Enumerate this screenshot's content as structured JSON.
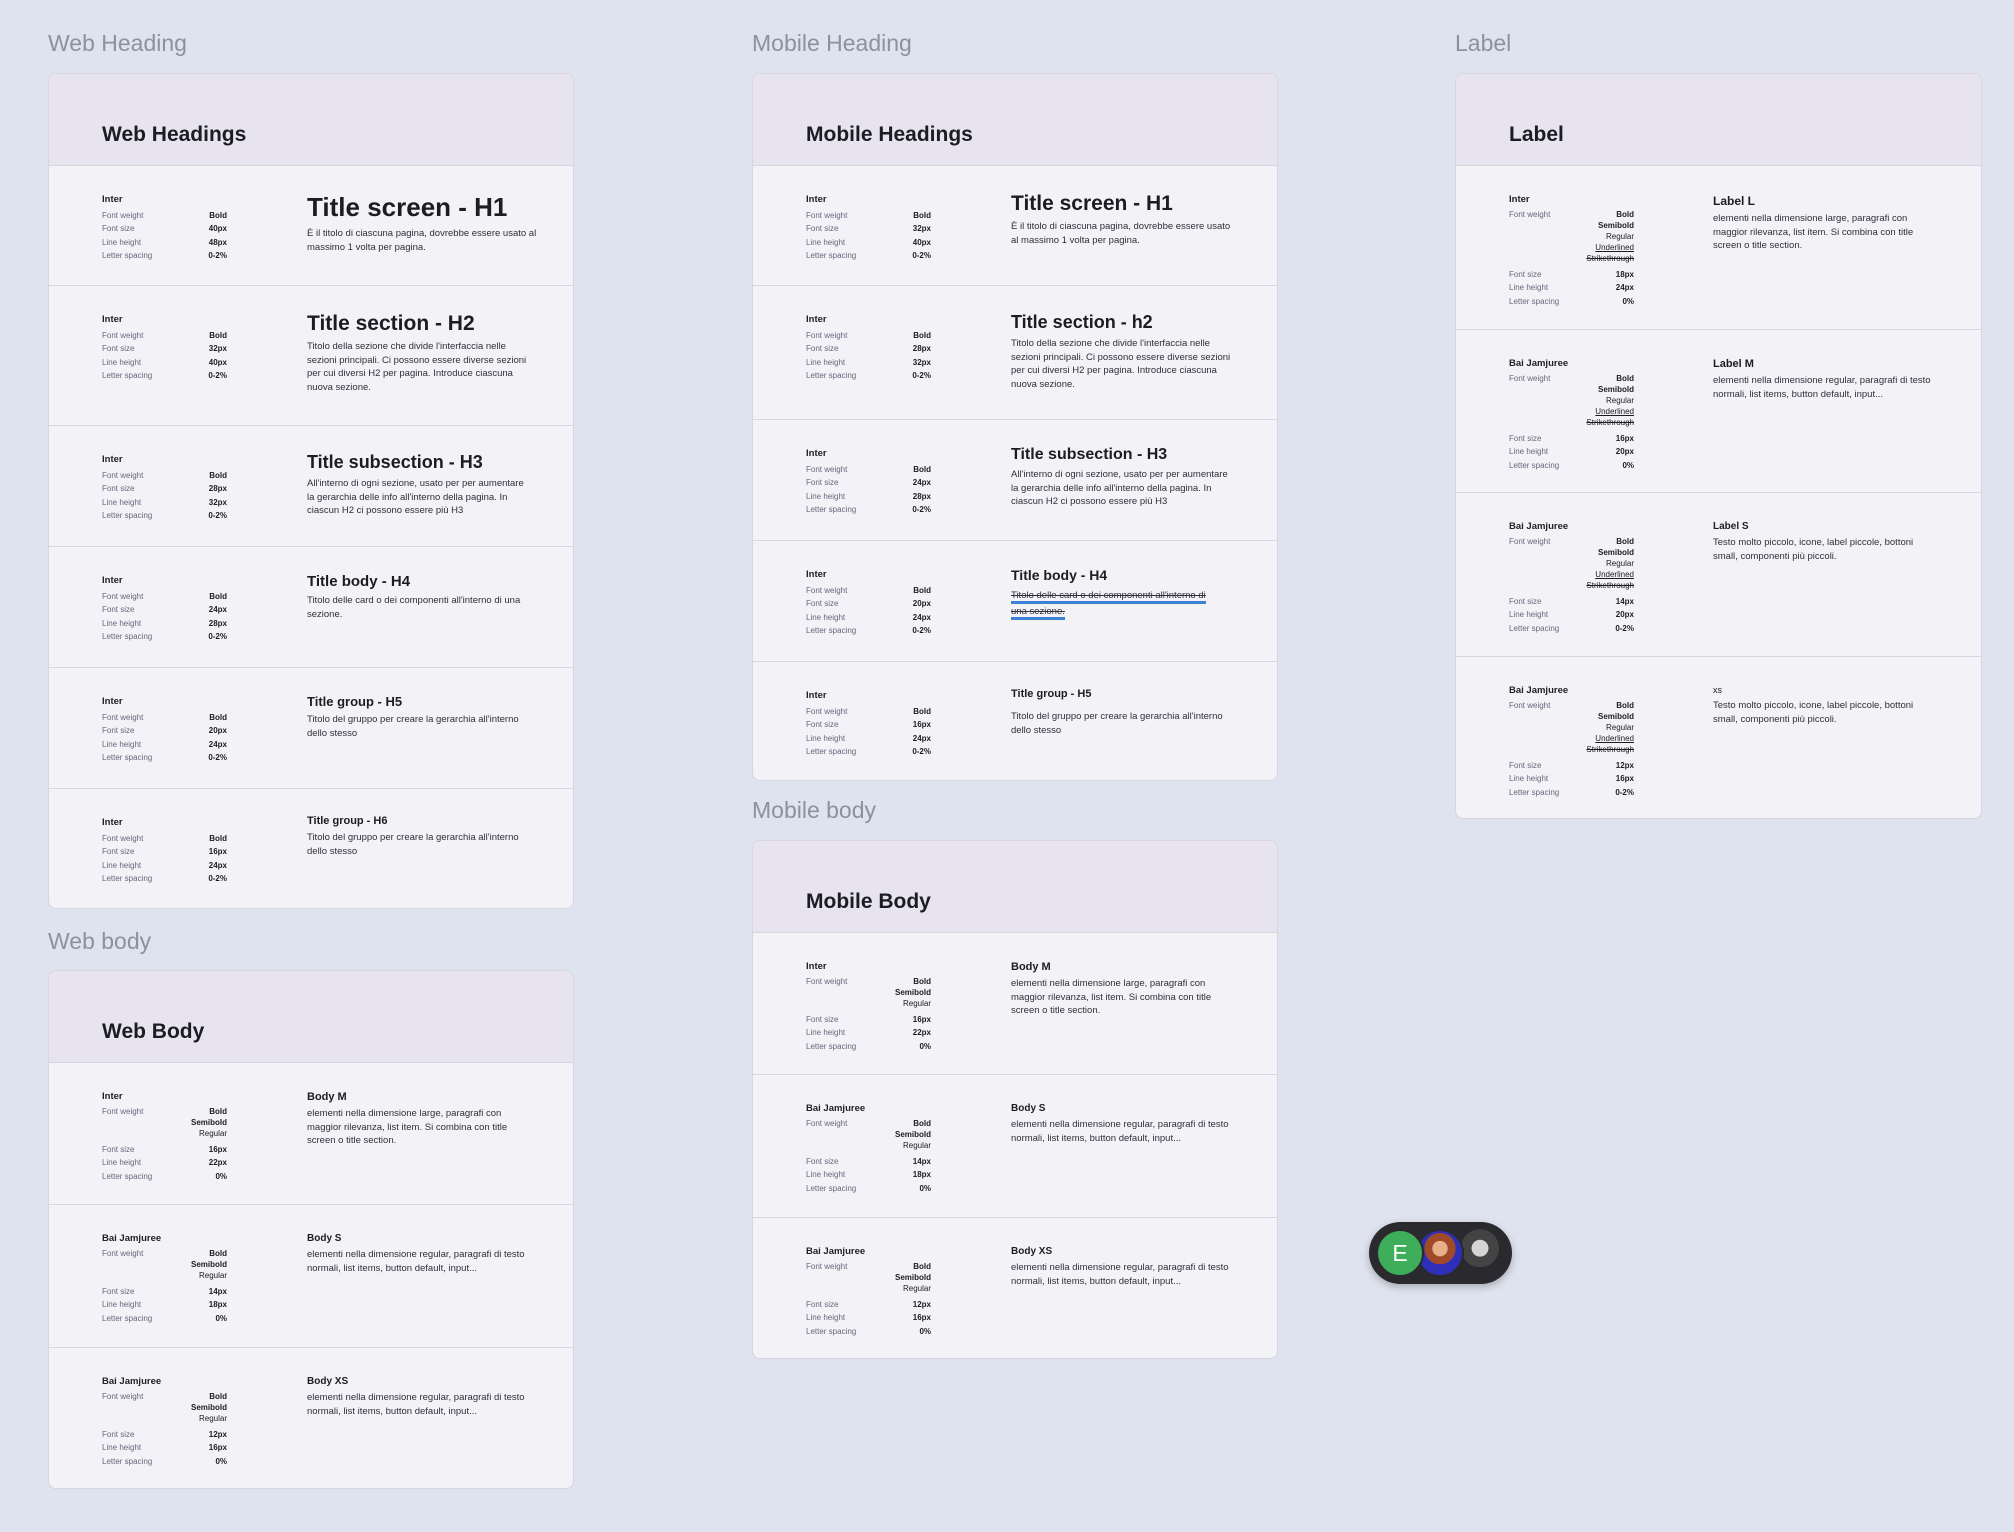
{
  "labels": {
    "web_heading": "Web Heading",
    "mobile_heading": "Mobile Heading",
    "label": "Label",
    "web_body": "Web body",
    "mobile_body": "Mobile body"
  },
  "spec_keys": {
    "weight": "Font weight",
    "size": "Font size",
    "lh": "Line height",
    "ls": "Letter spacing"
  },
  "weights": {
    "bold": "Bold",
    "semibold": "Semibold",
    "regular": "Regular",
    "underlined": "Underlined",
    "strikethrough": "Strikethrough"
  },
  "web_headings": {
    "title": "Web Headings",
    "rows": [
      {
        "font": "Inter",
        "weight": "Bold",
        "size": "40px",
        "lh": "48px",
        "ls": "0-2%",
        "title": "Title screen - H1",
        "desc": "È il titolo di ciascuna pagina, dovrebbe essere usato al massimo 1 volta per pagina."
      },
      {
        "font": "Inter",
        "weight": "Bold",
        "size": "32px",
        "lh": "40px",
        "ls": "0-2%",
        "title": "Title section - H2",
        "desc": "Titolo della sezione che divide l'interfaccia nelle sezioni principali. Ci possono essere diverse sezioni per cui diversi H2 per pagina. Introduce ciascuna nuova sezione."
      },
      {
        "font": "Inter",
        "weight": "Bold",
        "size": "28px",
        "lh": "32px",
        "ls": "0-2%",
        "title": "Title subsection - H3",
        "desc": "All'interno di ogni sezione, usato per per aumentare la gerarchia delle info all'interno della pagina. In ciascun H2 ci possono essere più H3"
      },
      {
        "font": "Inter",
        "weight": "Bold",
        "size": "24px",
        "lh": "28px",
        "ls": "0-2%",
        "title": "Title body - H4",
        "desc": "Titolo delle card o dei componenti all'interno di una sezione."
      },
      {
        "font": "Inter",
        "weight": "Bold",
        "size": "20px",
        "lh": "24px",
        "ls": "0-2%",
        "title": "Title group - H5",
        "desc": "Titolo del gruppo per creare la gerarchia all'interno dello stesso"
      },
      {
        "font": "Inter",
        "weight": "Bold",
        "size": "16px",
        "lh": "24px",
        "ls": "0-2%",
        "title": "Title group - H6",
        "desc": "Titolo del gruppo per creare la gerarchia all'interno dello stesso"
      }
    ]
  },
  "mobile_headings": {
    "title": "Mobile Headings",
    "rows": [
      {
        "font": "Inter",
        "weight": "Bold",
        "size": "32px",
        "lh": "40px",
        "ls": "0-2%",
        "title": "Title screen - H1",
        "desc": "È il titolo di ciascuna pagina, dovrebbe essere usato al massimo 1 volta per pagina."
      },
      {
        "font": "Inter",
        "weight": "Bold",
        "size": "28px",
        "lh": "32px",
        "ls": "0-2%",
        "title": "Title section - h2",
        "desc": "Titolo della sezione che divide l'interfaccia nelle sezioni principali. Ci possono essere diverse sezioni per cui diversi H2 per pagina. Introduce ciascuna nuova sezione."
      },
      {
        "font": "Inter",
        "weight": "Bold",
        "size": "24px",
        "lh": "28px",
        "ls": "0-2%",
        "title": "Title subsection - H3",
        "desc": "All'interno di ogni sezione, usato per per aumentare la gerarchia delle info all'interno della pagina. In ciascun H2 ci possono essere più H3"
      },
      {
        "font": "Inter",
        "weight": "Bold",
        "size": "20px",
        "lh": "24px",
        "ls": "0-2%",
        "title": "Title body - H4",
        "desc": "Titolo delle card o dei componenti all'interno di una sezione."
      },
      {
        "font": "Inter",
        "weight": "Bold",
        "size": "16px",
        "lh": "24px",
        "ls": "0-2%",
        "title": "Title group - H5",
        "desc": "Titolo del gruppo per creare la gerarchia all'interno dello stesso"
      }
    ]
  },
  "label_card": {
    "title": "Label",
    "rows": [
      {
        "font": "Inter",
        "size": "18px",
        "lh": "24px",
        "ls": "0%",
        "title": "Label L",
        "desc": "elementi nella dimensione large, paragrafi con maggior rilevanza, list item. Si combina con title screen o title section."
      },
      {
        "font": "Bai Jamjuree",
        "size": "16px",
        "lh": "20px",
        "ls": "0%",
        "title": "Label M",
        "desc": "elementi nella dimensione regular, paragrafi di testo normali, list items, button default, input..."
      },
      {
        "font": "Bai Jamjuree",
        "size": "14px",
        "lh": "20px",
        "ls": "0-2%",
        "title": "Label S",
        "desc": "Testo molto piccolo, icone, label piccole, bottoni small, componenti più piccoli."
      },
      {
        "font": "Bai Jamjuree",
        "size": "12px",
        "lh": "16px",
        "ls": "0-2%",
        "title": "xs",
        "desc": "Testo molto piccolo, icone, label piccole, bottoni small, componenti più piccoli."
      }
    ]
  },
  "web_body": {
    "title": "Web Body",
    "rows": [
      {
        "font": "Inter",
        "size": "16px",
        "lh": "22px",
        "ls": "0%",
        "title": "Body M",
        "desc": "elementi nella dimensione large, paragrafi con maggior rilevanza, list item. Si combina con title screen o title section."
      },
      {
        "font": "Bai Jamjuree",
        "size": "14px",
        "lh": "18px",
        "ls": "0%",
        "title": "Body S",
        "desc": "elementi nella dimensione regular, paragrafi di testo normali, list items, button default, input..."
      },
      {
        "font": "Bai Jamjuree",
        "size": "12px",
        "lh": "16px",
        "ls": "0%",
        "title": "Body XS",
        "desc": "elementi nella dimensione regular, paragrafi di testo normali, list items, button default, input..."
      }
    ]
  },
  "mobile_body": {
    "title": "Mobile Body",
    "rows": [
      {
        "font": "Inter",
        "size": "16px",
        "lh": "22px",
        "ls": "0%",
        "title": "Body M",
        "desc": "elementi nella dimensione large, paragrafi con maggior rilevanza, list item. Si combina con title screen o title section."
      },
      {
        "font": "Bai Jamjuree",
        "size": "14px",
        "lh": "18px",
        "ls": "0%",
        "title": "Body S",
        "desc": "elementi nella dimensione regular, paragrafi di testo normali, list items, button default, input..."
      },
      {
        "font": "Bai Jamjuree",
        "size": "12px",
        "lh": "16px",
        "ls": "0%",
        "title": "Body XS",
        "desc": "elementi nella dimensione regular, paragrafi di testo normali, list items, button default, input..."
      }
    ]
  },
  "collaborators": {
    "initial": "E",
    "colors": {
      "initial_bg": "#3fae5a",
      "pill_bg": "#2a2a2e",
      "page_bg": "#dfe3ef",
      "card_bg": "#f3f2f7",
      "header_bg": "#e7e4ef",
      "highlight": "#3b82d6"
    },
    "icons": [
      "user-initial-avatar",
      "user-photo-avatar",
      "user-photo-avatar"
    ]
  }
}
